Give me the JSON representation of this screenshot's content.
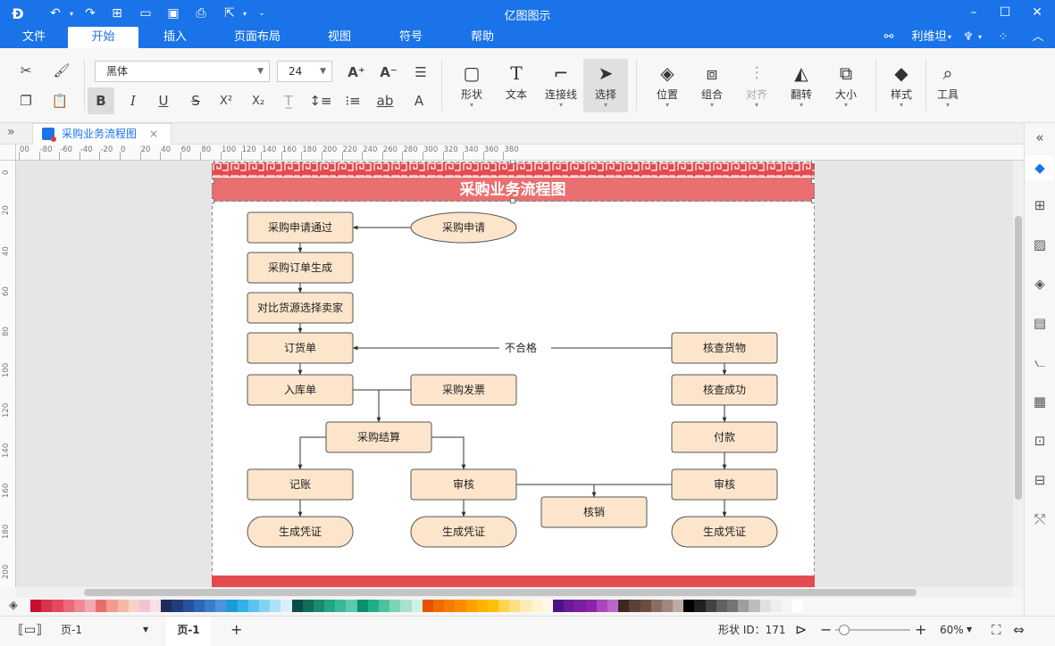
{
  "app": {
    "title": "亿图图示"
  },
  "menu": {
    "items": [
      "文件",
      "开始",
      "插入",
      "页面布局",
      "视图",
      "符号",
      "帮助"
    ],
    "active": "开始",
    "user": "利维坦"
  },
  "toolbar": {
    "font_family": "黑体",
    "font_size": "24",
    "big_buttons": {
      "shape": "形状",
      "text": "文本",
      "connector": "连接线",
      "select": "选择",
      "position": "位置",
      "group": "组合",
      "align": "对齐",
      "flip": "翻转",
      "size": "大小",
      "style": "样式",
      "tools": "工具"
    }
  },
  "tab": {
    "name": "采购业务流程图",
    "close": "×"
  },
  "ruler": {
    "h": [
      "00",
      "-80",
      "-60",
      "-40",
      "-20",
      "0",
      "20",
      "40",
      "60",
      "80",
      "100",
      "120",
      "140",
      "160",
      "180",
      "200",
      "220",
      "240",
      "260",
      "280",
      "300",
      "320",
      "340",
      "360",
      "380"
    ],
    "v": [
      "0",
      "20",
      "40",
      "60",
      "80",
      "100",
      "120",
      "140",
      "160",
      "180",
      "200"
    ]
  },
  "diagram": {
    "title": "采购业务流程图",
    "nodes": {
      "purchase_request": "采购申请",
      "request_approved": "采购申请通过",
      "order_generated": "采购订单生成",
      "compare_sources": "对比货源选择卖家",
      "order_sheet": "订货单",
      "inbound_sheet": "入库单",
      "invoice": "采购发票",
      "settlement": "采购结算",
      "bookkeeping": "记账",
      "audit_left": "审核",
      "writeoff": "核销",
      "check_goods": "核查货物",
      "check_success": "核查成功",
      "payment": "付款",
      "audit_right": "审核",
      "voucher_1": "生成凭证",
      "voucher_2": "生成凭证",
      "voucher_3": "生成凭证"
    },
    "edge_label": "不合格",
    "colors": {
      "node_fill": "#fde5cc",
      "node_stroke": "#555555",
      "title_band": "#e96f71",
      "border_band": "#e34b4f",
      "footer_band": "#e34b4f"
    }
  },
  "palette_colors": [
    "#c8102e",
    "#d6334a",
    "#e5495e",
    "#ea6a7a",
    "#ef8a96",
    "#f3a9b1",
    "#e86e6e",
    "#f09c8c",
    "#f5b9a9",
    "#f7d2c6",
    "#f1c4d6",
    "#f7e0ea",
    "#1f2c5c",
    "#233d7a",
    "#2a5298",
    "#2f67b5",
    "#3a7dd0",
    "#4a95dc",
    "#1b9cd8",
    "#32b2e6",
    "#59c4ee",
    "#82d3f3",
    "#aee2f7",
    "#d7f0fb",
    "#0c4e45",
    "#136b5a",
    "#1a8a70",
    "#21a585",
    "#3ab99a",
    "#5ccab0",
    "#0d8f6f",
    "#1fae88",
    "#4cc29e",
    "#7dd3b6",
    "#a8e2cd",
    "#d1f0e4",
    "#e65100",
    "#ef6c00",
    "#f57c00",
    "#fb8c00",
    "#ffa000",
    "#ffb300",
    "#ffc107",
    "#ffd54f",
    "#ffe082",
    "#ffecb3",
    "#fff3d0",
    "#fff8e6",
    "#4a148c",
    "#6a1b9a",
    "#7b1fa2",
    "#8e24aa",
    "#ab47bc",
    "#ba68c8",
    "#3e2723",
    "#5d4037",
    "#6d4c41",
    "#8d6e63",
    "#a1887f",
    "#bcaaa4",
    "#000000",
    "#212121",
    "#424242",
    "#616161",
    "#757575",
    "#9e9e9e",
    "#bdbdbd",
    "#e0e0e0",
    "#eeeeee",
    "#f5f5f5",
    "#ffffff"
  ],
  "statusbar": {
    "page_select": "页-1",
    "page_tab": "页-1",
    "add": "+",
    "shape_id": "形状 ID：171",
    "zoom": "60%",
    "zoom_fraction": 0.12
  }
}
